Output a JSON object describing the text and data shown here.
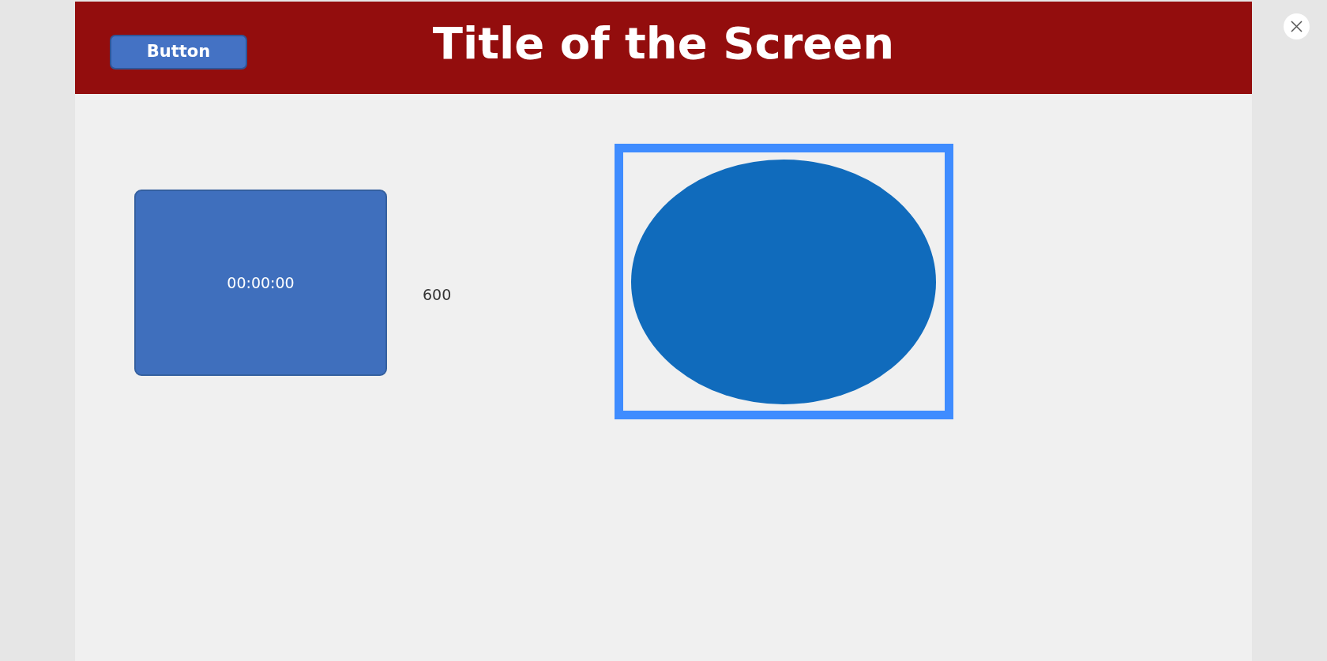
{
  "header": {
    "title": "Title of the Screen",
    "button": "Button"
  },
  "timer": {
    "text": "00:00:00"
  },
  "label": {
    "text": "600"
  },
  "shape": {
    "kind": "ellipse",
    "selected": true
  }
}
